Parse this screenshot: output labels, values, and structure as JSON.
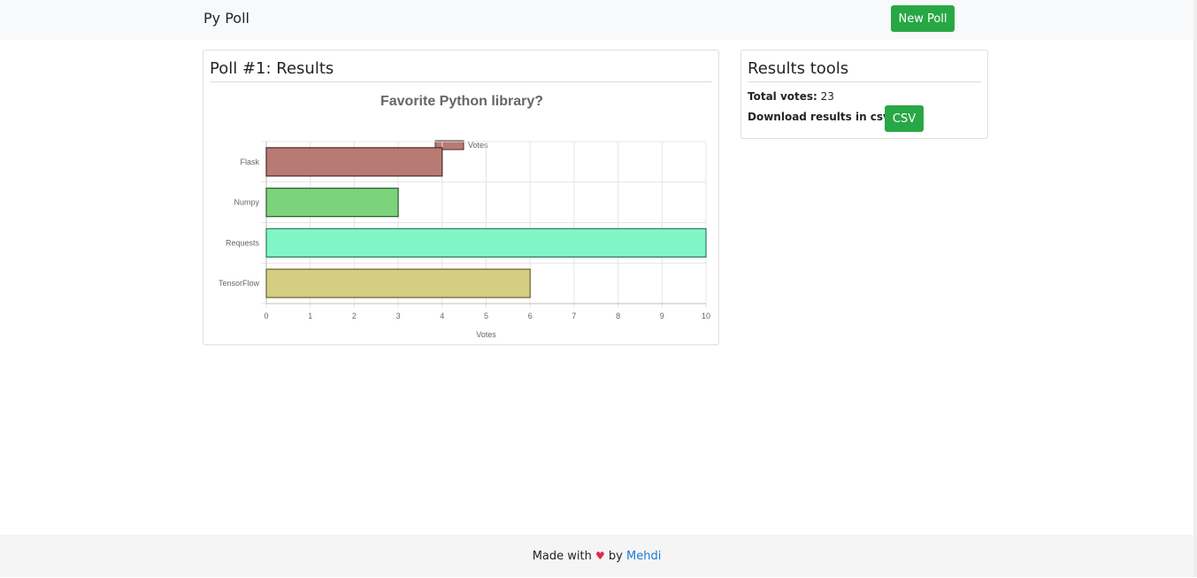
{
  "nav": {
    "brand": "Py Poll",
    "new_poll_label": "New Poll"
  },
  "poll_card": {
    "title": "Poll #1: Results"
  },
  "chart_data": {
    "type": "bar",
    "orientation": "horizontal",
    "title": "Favorite Python library?",
    "categories": [
      "Flask",
      "Numpy",
      "Requests",
      "TensorFlow"
    ],
    "series": [
      {
        "name": "Votes",
        "values": [
          4,
          3,
          10,
          6
        ]
      }
    ],
    "xlabel": "Votes",
    "ylabel": "",
    "xlim": [
      0,
      10
    ],
    "x_ticks": [
      "0",
      "1",
      "2",
      "3",
      "4",
      "5",
      "6",
      "7",
      "8",
      "9",
      "10"
    ],
    "grid": true,
    "legend_position": "top",
    "bar_colors": [
      "#b97a74",
      "#7bd37b",
      "#80f5c6",
      "#d4cd82"
    ],
    "bar_border_colors": [
      "#4a2a28",
      "#2d5a2d",
      "#2e7a60",
      "#6a6430"
    ]
  },
  "tools_card": {
    "title": "Results tools",
    "total_votes_label": "Total votes:",
    "total_votes_value": "23",
    "download_label": "Download results in csv:",
    "csv_button_label": "CSV"
  },
  "footer": {
    "prefix": "Made with",
    "heart": "♥",
    "by": "by",
    "author": "Mehdi"
  }
}
